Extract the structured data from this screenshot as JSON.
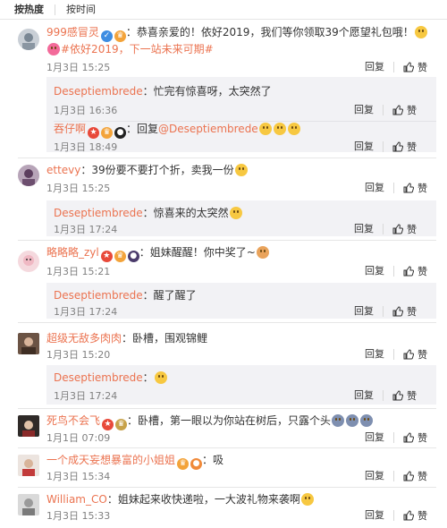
{
  "sort": {
    "hot": "按热度",
    "time": "按时间"
  },
  "common": {
    "reply": "回复",
    "like": "赞"
  },
  "colors": {
    "username": "#eb7350",
    "sub_bg": "#f2f2f5",
    "meta": "#808080"
  },
  "comments": [
    {
      "user": "999感冒灵",
      "text": "：恭喜亲爱的！依好2019，我们等你领取39个愿望礼包哦！",
      "topic": "#依好2019，下一站未来可期#",
      "time": "1月3日 15:25",
      "replies": [
        {
          "user": "Deseptiembrede",
          "text": "：忙完有惊喜呀，太突然了",
          "time": "1月3日 16:36"
        },
        {
          "user": "吞仔啊",
          "text": "：回复",
          "mention": "@Deseptiembrede",
          "time": "1月3日 18:49"
        }
      ]
    },
    {
      "user": "ettevy",
      "text": "：39份要不要打个折，卖我一份",
      "time": "1月3日 15:25",
      "replies": [
        {
          "user": "Deseptiembrede",
          "text": "：惊喜来的太突然",
          "time": "1月3日 17:24"
        }
      ]
    },
    {
      "user": "略略略_zyl",
      "text": "：姐妹醒醒！你中奖了~",
      "time": "1月3日 15:21",
      "replies": [
        {
          "user": "Deseptiembrede",
          "text": "：醒了醒了",
          "time": "1月3日 17:24"
        }
      ]
    },
    {
      "user": "超级无敌多肉肉",
      "text": "：卧槽，围观锦鲤",
      "time": "1月3日 15:20",
      "replies": [
        {
          "user": "Deseptiembrede",
          "text": "：",
          "time": "1月3日 17:24"
        }
      ]
    },
    {
      "user": "死鸟不会飞",
      "text": "：卧槽，第一眼以为你站在树后，只露个头",
      "time": "1月1日 07:09",
      "replies": []
    },
    {
      "user": "一个成天妄想暴富的小姐姐",
      "text": "：吸",
      "time": "1月3日 15:34",
      "replies": []
    },
    {
      "user": "William_CO",
      "text": "：姐妹起来收快递啦，一大波礼物来袭啊",
      "time": "1月3日 15:33",
      "replies": []
    }
  ]
}
